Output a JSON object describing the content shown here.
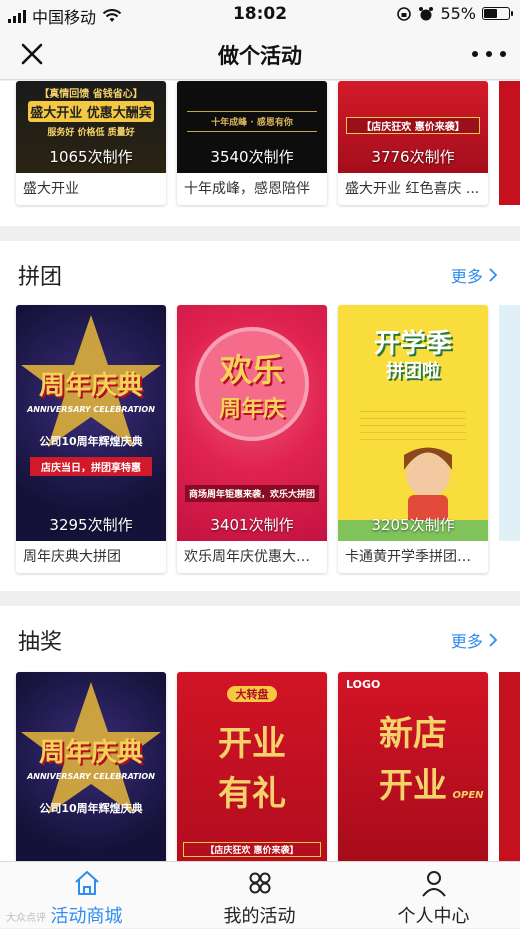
{
  "status_bar": {
    "carrier": "中国移动",
    "time": "18:02",
    "battery_percent": "55%",
    "battery_level": 0.55
  },
  "nav": {
    "title": "做个活动",
    "close_icon": "close-icon",
    "more_icon": "more-dots-icon"
  },
  "sections": [
    {
      "title": "",
      "cards": [
        {
          "count": "1065次制作",
          "name": "盛大开业",
          "poster_lines": [
            "【真情回馈 省钱省心】",
            "盛大开业 优惠大酬宾",
            "服务好 价格低 质量好"
          ]
        },
        {
          "count": "3540次制作",
          "name": "十年成峰，感恩陪伴",
          "poster_lines": [
            "十年成峰 · 感恩有你"
          ]
        },
        {
          "count": "3776次制作",
          "name": "盛大开业 红色喜庆 ...",
          "poster_lines": [
            "【店庆狂欢 惠价来袭】"
          ]
        }
      ]
    },
    {
      "title": "拼团",
      "more_label": "更多",
      "cards": [
        {
          "count": "3295次制作",
          "name": "周年庆典大拼团",
          "poster_lines": [
            "周年庆典",
            "ANNIVERSARY CELEBRATION",
            "公司10周年辉煌庆典",
            "店庆当日，拼团享特惠"
          ]
        },
        {
          "count": "3401次制作",
          "name": "欢乐周年庆优惠大拼团",
          "poster_lines": [
            "欢乐",
            "周年庆",
            "商场周年钜惠来袭，欢乐大拼团"
          ]
        },
        {
          "count": "3205次制作",
          "name": "卡通黄开学季拼团活动",
          "poster_lines": [
            "开学季",
            "拼团啦"
          ]
        }
      ]
    },
    {
      "title": "抽奖",
      "more_label": "更多",
      "cards": [
        {
          "count": "",
          "name": "",
          "poster_lines": [
            "周年庆典",
            "ANNIVERSARY CELEBRATION",
            "公司10周年辉煌庆典"
          ]
        },
        {
          "count": "",
          "name": "",
          "poster_lines": [
            "大转盘",
            "开业",
            "有礼",
            "【店庆狂欢 惠价来袭】"
          ]
        },
        {
          "count": "",
          "name": "",
          "poster_lines": [
            "LOGO",
            "新店",
            "开业",
            "OPEN"
          ]
        }
      ]
    }
  ],
  "tabs": [
    {
      "label": "活动商城",
      "icon": "home-icon",
      "active": true
    },
    {
      "label": "我的活动",
      "icon": "grid-icon",
      "active": false
    },
    {
      "label": "个人中心",
      "icon": "person-icon",
      "active": false
    }
  ],
  "watermark": "大众点评",
  "colors": {
    "accent": "#2f8cf0",
    "poster_red": "#c8102e",
    "poster_gold": "#f5c843"
  }
}
